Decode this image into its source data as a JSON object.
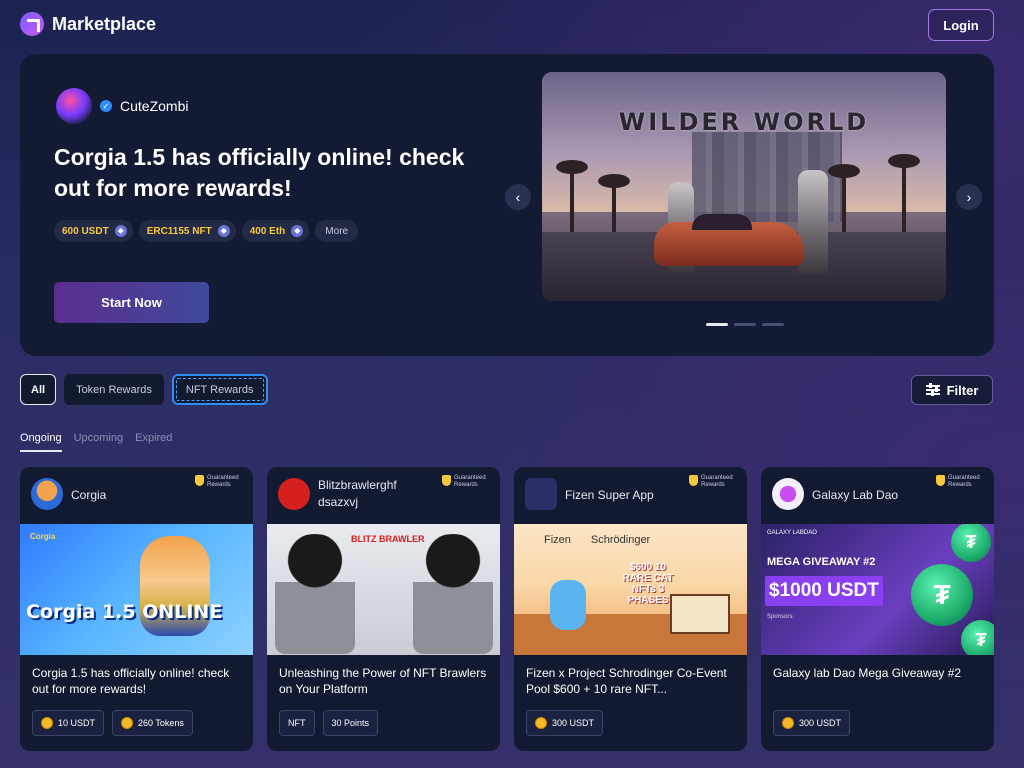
{
  "app": {
    "name": "Marketplace",
    "login_label": "Login"
  },
  "hero": {
    "creator": "CuteZombi",
    "title": "Corgia 1.5 has officially online! check out for more rewards!",
    "rewards": [
      "600 USDT",
      "ERC1155 NFT",
      "400 Eth"
    ],
    "more_label": "More",
    "cta_label": "Start Now",
    "slide_title": "WILDER WORLD",
    "prev_icon": "chevron-left-icon",
    "next_icon": "chevron-right-icon",
    "slides_total": 3,
    "slide_active": 1
  },
  "filters": {
    "types": [
      "All",
      "Token Rewards",
      "NFT Rewards"
    ],
    "active_type": "All",
    "filter_label": "Filter",
    "statuses": [
      "Ongoing",
      "Upcoming",
      "Expired"
    ],
    "active_status": "Ongoing"
  },
  "cards": [
    {
      "name": "Corgia",
      "guarantee": "Guaranteed Rewards",
      "image_text": "Corgia 1.5 ONLINE",
      "image_small": "Corgia",
      "title": "Corgia 1.5 has officially online! check out for more rewards!",
      "rewards": [
        "10 USDT",
        "260 Tokens"
      ]
    },
    {
      "name": "Blitzbrawlerghf dsazxvj",
      "guarantee": "Guaranteed Rewards",
      "image_text": "BLITZ BRAWLER",
      "title": "Unleashing the Power of NFT Brawlers on Your Platform",
      "rewards": [
        "NFT",
        "30 Points"
      ]
    },
    {
      "name": "Fizen Super App",
      "guarantee": "Guaranteed Rewards",
      "image_brand_1": "Fizen",
      "image_brand_2": "Schrödinger",
      "image_text": "$600 10 RARE CAT NFTs 3 PHASES",
      "title": "Fizen x Project Schrodinger Co-Event Pool $600 + 10 rare NFT...",
      "rewards": [
        "300 USDT"
      ]
    },
    {
      "name": "Galaxy Lab Dao",
      "guarantee": "Guaranteed Rewards",
      "image_text_1": "MEGA GIVEAWAY #2",
      "image_text_2": "$1000 USDT",
      "image_sponsors": "Sponsors:",
      "image_badge": "GALAXY LABDAO",
      "title": "Galaxy lab Dao Mega Giveaway #2",
      "rewards": [
        "300 USDT"
      ]
    }
  ],
  "colors": {
    "accent": "#a37be8",
    "reward_text": "#f5c93b",
    "focus_ring": "#2e8df5",
    "card_bg": "#121a32"
  }
}
